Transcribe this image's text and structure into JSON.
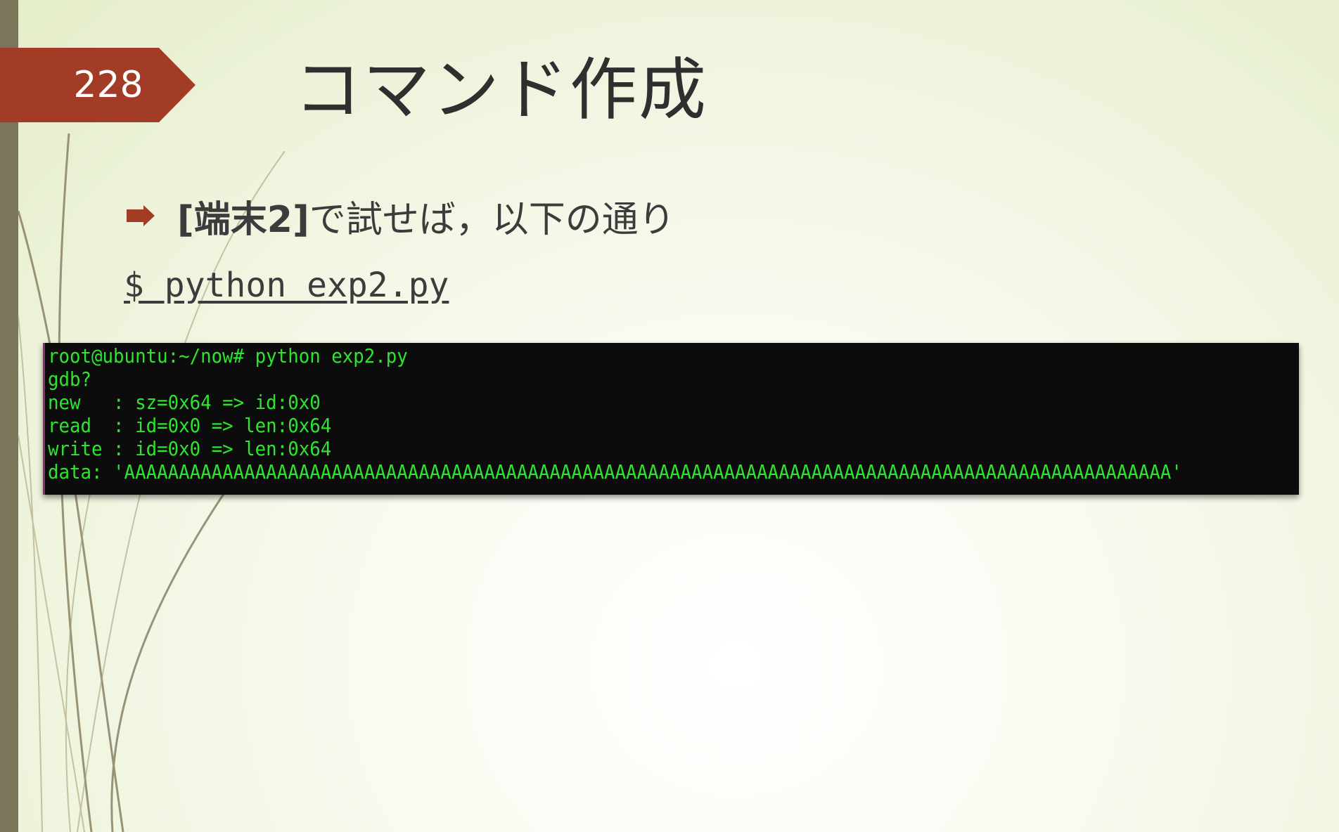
{
  "slide": {
    "number": "228",
    "title": "コマンド作成",
    "bullet": {
      "bold": "[端末2]",
      "rest": "で試せば，以下の通り"
    },
    "command": "$ python exp2.py"
  },
  "terminal": {
    "lines": [
      "root@ubuntu:~/now# python exp2.py",
      "gdb?",
      "new   : sz=0x64 => id:0x0",
      "read  : id=0x0 => len:0x64",
      "write : id=0x0 => len:0x64",
      "data: 'AAAAAAAAAAAAAAAAAAAAAAAAAAAAAAAAAAAAAAAAAAAAAAAAAAAAAAAAAAAAAAAAAAAAAAAAAAAAAAAAAAAAAAAAAAAAAAAA'"
    ]
  },
  "colors": {
    "accent": "#a33c26",
    "side_bar": "#7b7559",
    "terminal_bg": "#0c0c0c",
    "terminal_text": "#2ee42e"
  }
}
